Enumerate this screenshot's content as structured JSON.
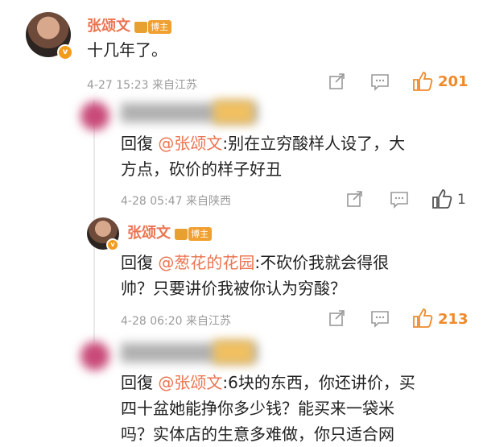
{
  "main": {
    "user": "张颂文",
    "badge": "博主",
    "text": "十几年了。",
    "time": "4-27 15:23",
    "source": "来自江苏",
    "likes": "201"
  },
  "reply1": {
    "reply_prefix": "回復",
    "mention": "@张颂文",
    "text_line1": ":别在立穷酸样人设了，大",
    "text_line2": "方点，砍价的样子好丑",
    "time": "4-28 05:47",
    "source": "来自陕西",
    "likes": "1"
  },
  "reply2": {
    "user": "张颂文",
    "badge": "博主",
    "reply_prefix": "回復",
    "mention": "@葱花的花园",
    "text_line1": ":不砍价我就会得很",
    "text_line2": "帅？只要讲价我被你认为穷酸？",
    "time": "4-28 06:20",
    "source": "来自江苏",
    "likes": "213"
  },
  "reply3": {
    "reply_prefix": "回復",
    "mention": "@张颂文",
    "text_line1": ":6块的东西，你还讲价，买",
    "text_line2": "四十盆她能挣你多少钱？能买来一袋米",
    "text_line3": "吗？实体店的生意多难做，你只适合网"
  },
  "colors": {
    "accent": "#eb7350",
    "badge": "#f0a030",
    "like_active": "#ee8a2a"
  },
  "icons": [
    "share-icon",
    "comment-icon",
    "thumbs-up-icon",
    "verified-badge-icon",
    "crown-icon"
  ]
}
